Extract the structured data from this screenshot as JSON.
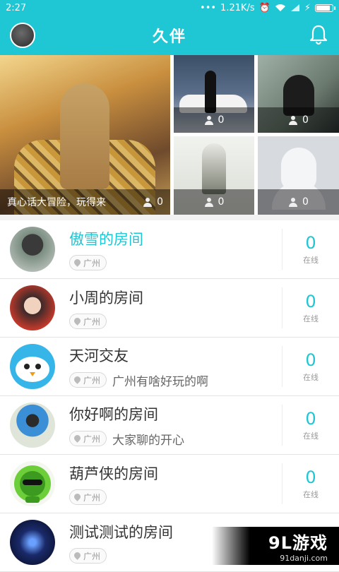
{
  "status_bar": {
    "time": "2:27",
    "network_speed": "1.21K/s",
    "icons": [
      "dots-icon",
      "alarm-icon",
      "wifi-icon",
      "signal-icon",
      "battery-icon"
    ]
  },
  "app_bar": {
    "title": "久伴",
    "avatar_icon": "user-avatar-icon",
    "bell_icon": "bell-icon"
  },
  "featured": [
    {
      "name": "真心话大冒险，玩得来",
      "count": "0"
    },
    {
      "name": "",
      "count": "0"
    },
    {
      "name": "",
      "count": "0"
    },
    {
      "name": "",
      "count": "0"
    },
    {
      "name": "",
      "count": "0"
    }
  ],
  "rooms": [
    {
      "name": "傲雪的房间",
      "location": "广州",
      "desc": "",
      "online": "0",
      "online_label": "在线"
    },
    {
      "name": "小周的房间",
      "location": "广州",
      "desc": "",
      "online": "0",
      "online_label": "在线"
    },
    {
      "name": "天河交友",
      "location": "广州",
      "desc": "广州有啥好玩的啊",
      "online": "0",
      "online_label": "在线"
    },
    {
      "name": "你好啊的房间",
      "location": "广州",
      "desc": "大家聊的开心",
      "online": "0",
      "online_label": "在线"
    },
    {
      "name": "葫芦侠的房间",
      "location": "广州",
      "desc": "",
      "online": "0",
      "online_label": "在线"
    },
    {
      "name": "测试测试的房间",
      "location": "广州",
      "desc": "",
      "online": "",
      "online_label": ""
    }
  ],
  "watermark": {
    "brand": "9L游戏",
    "url": "91danji.com"
  },
  "colors": {
    "accent": "#1fc6d3"
  }
}
